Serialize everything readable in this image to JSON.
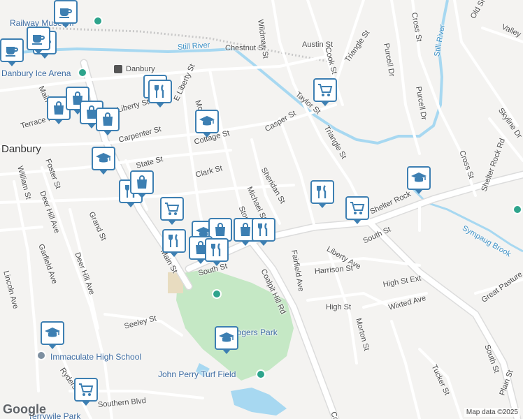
{
  "map": {
    "attribution": "Map data ©2025",
    "logo": "Google",
    "colors": {
      "land": "#f4f3f1",
      "road": "#ffffff",
      "road_outline": "#d9d9d9",
      "major_road": "#e3e3e3",
      "park": "#c5e8c5",
      "water": "#a7d8f1",
      "pin_border": "#3d7fb2",
      "poi_text": "#3b6aa0"
    }
  },
  "labels": {
    "danbury": "Danbury",
    "railway_museum": "Railway Museum",
    "danbury_ice_arena": "Danbury Ice Arena",
    "danbury_station": "Danbury",
    "still_river": "Still River",
    "still_river_2": "Still River",
    "sympaug_brook": "Sympaug Brook",
    "immaculate_hs": "Immaculate High School",
    "john_perry": "John Perry Turf Field",
    "rogers_park": "Rogers Park",
    "wildman_st": "Wildman St",
    "chestnut_st": "Chestnut St",
    "austin_st": "Austin St",
    "cook_st": "Cook St",
    "triangle_st_n": "Triangle St",
    "triangle_st": "Triangle St",
    "purcell_dr": "Purcell Dr",
    "purcell_dr_2": "Purcell Dr",
    "cross_st": "Cross St",
    "cross_st_2": "Cross St",
    "old_shelter": "Old Shelter",
    "valley": "Valley",
    "skyline_dr": "Skyline Dr",
    "shelter_rock_rd": "Shelter Rock Rd",
    "shelter_rock": "Shelter Rock",
    "taylor_st": "Taylor St",
    "casper_st": "Casper St",
    "sheridan_st": "Sheridan St",
    "michael_st": "Michael St",
    "stone_st": "Stone St",
    "e_liberty_st": "E Liberty St",
    "liberty_st": "Liberty St",
    "cottage_st": "Cottage St",
    "clark_st": "Clark St",
    "mcbride": "McBride",
    "carpenter_st": "Carpenter St",
    "state_st": "State St",
    "terrace_pl": "Terrace Pl",
    "foster_st": "Foster St",
    "william_st": "William St",
    "deer_hill_ave": "Deer Hill Ave",
    "deer_hill_ave_2": "Deer Hill Ave",
    "grand_st": "Grand St",
    "garfield_ave": "Garfield Ave",
    "lincoln_ave": "Lincoln Ave",
    "main_st": "Main St",
    "main_st_2": "Main St",
    "south_st": "South St",
    "south_st_2": "South St",
    "south_st_3": "South St",
    "coalpit_hill_rd": "Coalpit Hill Rd",
    "fairfield_ave": "Fairfield Ave",
    "liberty_ave": "Liberty Ave",
    "harrison_st": "Harrison St",
    "high_st_ext": "High St Ext",
    "high_st": "High St",
    "wixted_ave": "Wixted Ave",
    "morton_st": "Morton St",
    "great_pasture": "Great Pasture",
    "tucker_st": "Tucker St",
    "plain_st": "Plain St",
    "seeley_st": "Seeley St",
    "ryders": "Ryders",
    "southern_blvd": "Southern Blvd",
    "terrywile_park": "Terrywile Park",
    "cory": "Co",
    "cross_st_top": "Cross St",
    "maple": "Mai",
    "white_st": "Wh"
  },
  "pins": [
    {
      "icon": "coffee"
    },
    {
      "icon": "coffee"
    },
    {
      "icon": "coffee"
    },
    {
      "icon": "coffee"
    },
    {
      "icon": "shopping-bag"
    },
    {
      "icon": "restaurant"
    },
    {
      "icon": "restaurant"
    },
    {
      "icon": "shopping-bag"
    },
    {
      "icon": "shopping-bag"
    },
    {
      "icon": "shopping-bag"
    },
    {
      "icon": "school"
    },
    {
      "icon": "school"
    },
    {
      "icon": "restaurant"
    },
    {
      "icon": "shopping-bag"
    },
    {
      "icon": "grocery-cart"
    },
    {
      "icon": "school"
    },
    {
      "icon": "shopping-bag"
    },
    {
      "icon": "shopping-bag"
    },
    {
      "icon": "restaurant"
    },
    {
      "icon": "restaurant"
    },
    {
      "icon": "shopping-bag"
    },
    {
      "icon": "restaurant"
    },
    {
      "icon": "grocery-cart"
    },
    {
      "icon": "restaurant"
    },
    {
      "icon": "grocery-cart"
    },
    {
      "icon": "school"
    },
    {
      "icon": "school"
    },
    {
      "icon": "school"
    },
    {
      "icon": "grocery-cart"
    }
  ]
}
